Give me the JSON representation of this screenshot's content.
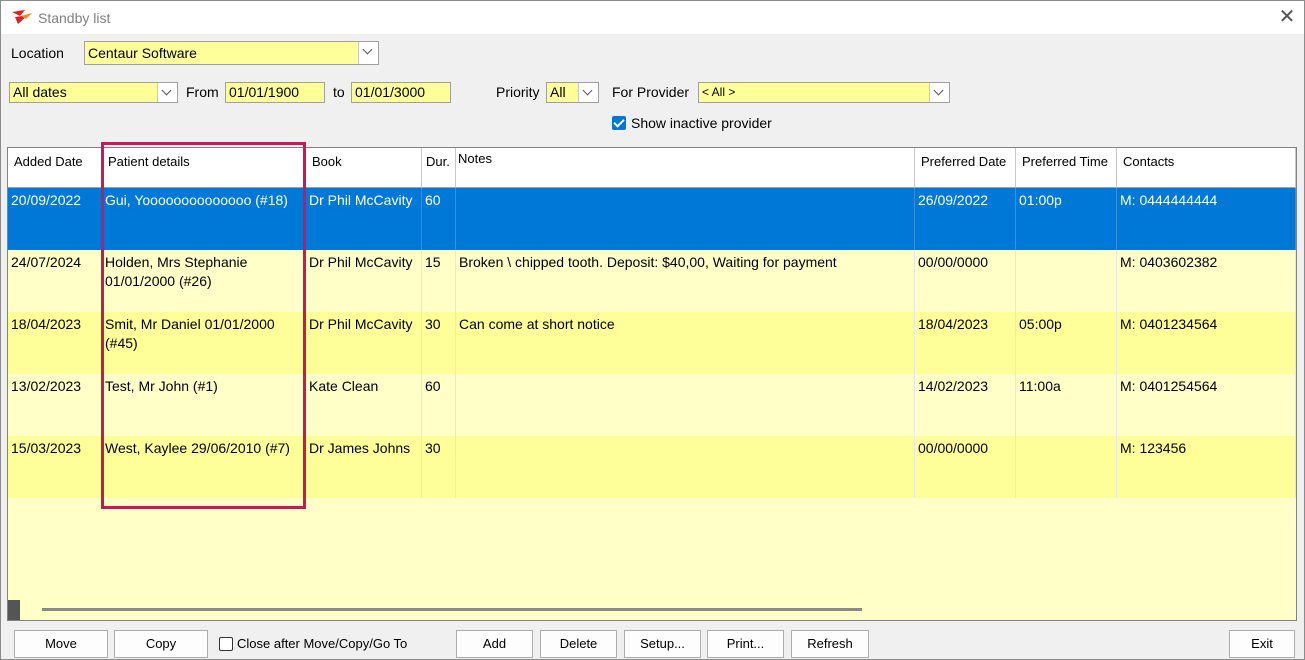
{
  "window": {
    "title": "Standby list"
  },
  "filters": {
    "location_label": "Location",
    "location_value": "Centaur Software",
    "date_range_value": "All dates",
    "from_label": "From",
    "from_value": "01/01/1900",
    "to_label": "to",
    "to_value": "01/01/3000",
    "priority_label": "Priority",
    "priority_value": "All",
    "provider_label": "For Provider",
    "provider_value": "< All >",
    "show_inactive_label": "Show inactive provider"
  },
  "table": {
    "columns": {
      "added_date": "Added Date",
      "patient": "Patient details",
      "book": "Book",
      "dur": "Dur.",
      "notes": "Notes",
      "pref_date": "Preferred Date",
      "pref_time": "Preferred Time",
      "contacts": "Contacts"
    },
    "rows": [
      {
        "added": "20/09/2022",
        "patient": "Gui, Yoooooooooooooo (#18)",
        "book": "Dr Phil McCavity",
        "dur": "60",
        "notes": "",
        "pref_date": "26/09/2022",
        "pref_time": "01:00p",
        "contacts": "M: 0444444444"
      },
      {
        "added": "24/07/2024",
        "patient": "Holden, Mrs Stephanie 01/01/2000 (#26)",
        "book": "Dr Phil McCavity",
        "dur": "15",
        "notes": "Broken \\ chipped tooth.  Deposit: $40,00, Waiting for payment",
        "pref_date": "00/00/0000",
        "pref_time": "",
        "contacts": "M: 0403602382"
      },
      {
        "added": "18/04/2023",
        "patient": "Smit, Mr Daniel 01/01/2000 (#45)",
        "book": "Dr Phil McCavity",
        "dur": "30",
        "notes": "Can come at short notice",
        "pref_date": "18/04/2023",
        "pref_time": "05:00p",
        "contacts": "M: 0401234564"
      },
      {
        "added": "13/02/2023",
        "patient": "Test, Mr John (#1)",
        "book": "Kate Clean",
        "dur": "60",
        "notes": "",
        "pref_date": "14/02/2023",
        "pref_time": "11:00a",
        "contacts": "M: 0401254564"
      },
      {
        "added": "15/03/2023",
        "patient": "West, Kaylee 29/06/2010 (#7)",
        "book": "Dr James Johns",
        "dur": "30",
        "notes": "",
        "pref_date": "00/00/0000",
        "pref_time": "",
        "contacts": "M: 123456"
      }
    ]
  },
  "buttons": {
    "move": "Move",
    "copy": "Copy",
    "close_after_label": "Close after Move/Copy/Go To",
    "add": "Add",
    "delete": "Delete",
    "setup": "Setup...",
    "print": "Print...",
    "refresh": "Refresh",
    "exit": "Exit"
  },
  "colors": {
    "input_yellow": "#ffff99",
    "row_light": "#ffffc8",
    "row_dark": "#ffff99",
    "selected_row": "#0078d7",
    "annotation_box": "#d0145a"
  }
}
